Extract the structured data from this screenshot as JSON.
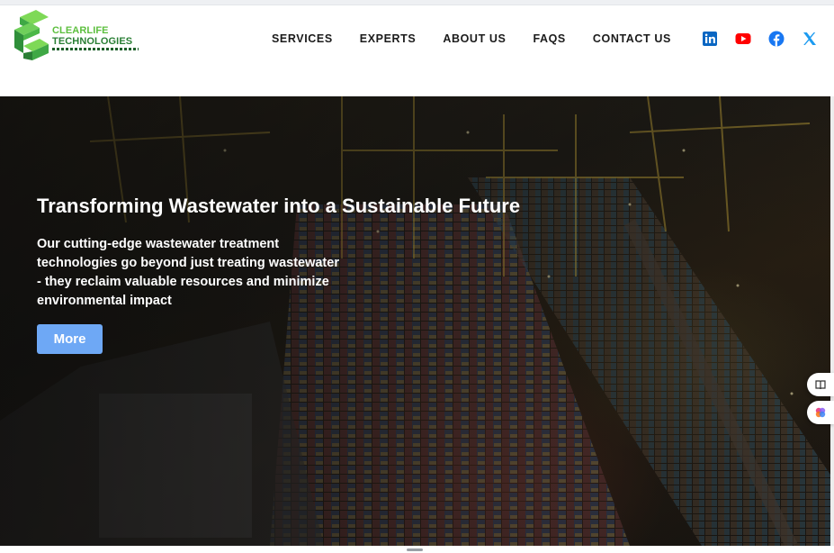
{
  "brand": {
    "name_line1": "CLEARLIFE",
    "name_line2": "TECHNOLOGIES",
    "colors": {
      "light_green": "#5cbf3e",
      "dark_green": "#2a7f35"
    }
  },
  "nav": {
    "items": [
      {
        "label": "SERVICES"
      },
      {
        "label": "EXPERTS"
      },
      {
        "label": "ABOUT US"
      },
      {
        "label": "FAQS"
      },
      {
        "label": "CONTACT US"
      }
    ]
  },
  "social": [
    {
      "icon": "linkedin-icon",
      "color": "#0a66c2"
    },
    {
      "icon": "youtube-icon",
      "color": "#ff0000"
    },
    {
      "icon": "facebook-icon",
      "color": "#1877f2"
    },
    {
      "icon": "x-twitter-icon",
      "color": "#1d9bf0"
    }
  ],
  "hero": {
    "title": "Transforming Wastewater into a Sustainable Future",
    "text": "Our cutting-edge wastewater treatment technologies go beyond just treating wastewater - they reclaim valuable resources and minimize environmental impact",
    "button_label": "More",
    "button_color": "#6ea8f5",
    "background": "night aerial photo of a container port"
  },
  "widgets": [
    {
      "icon": "book-icon"
    },
    {
      "icon": "ai-assistant-icon"
    }
  ]
}
